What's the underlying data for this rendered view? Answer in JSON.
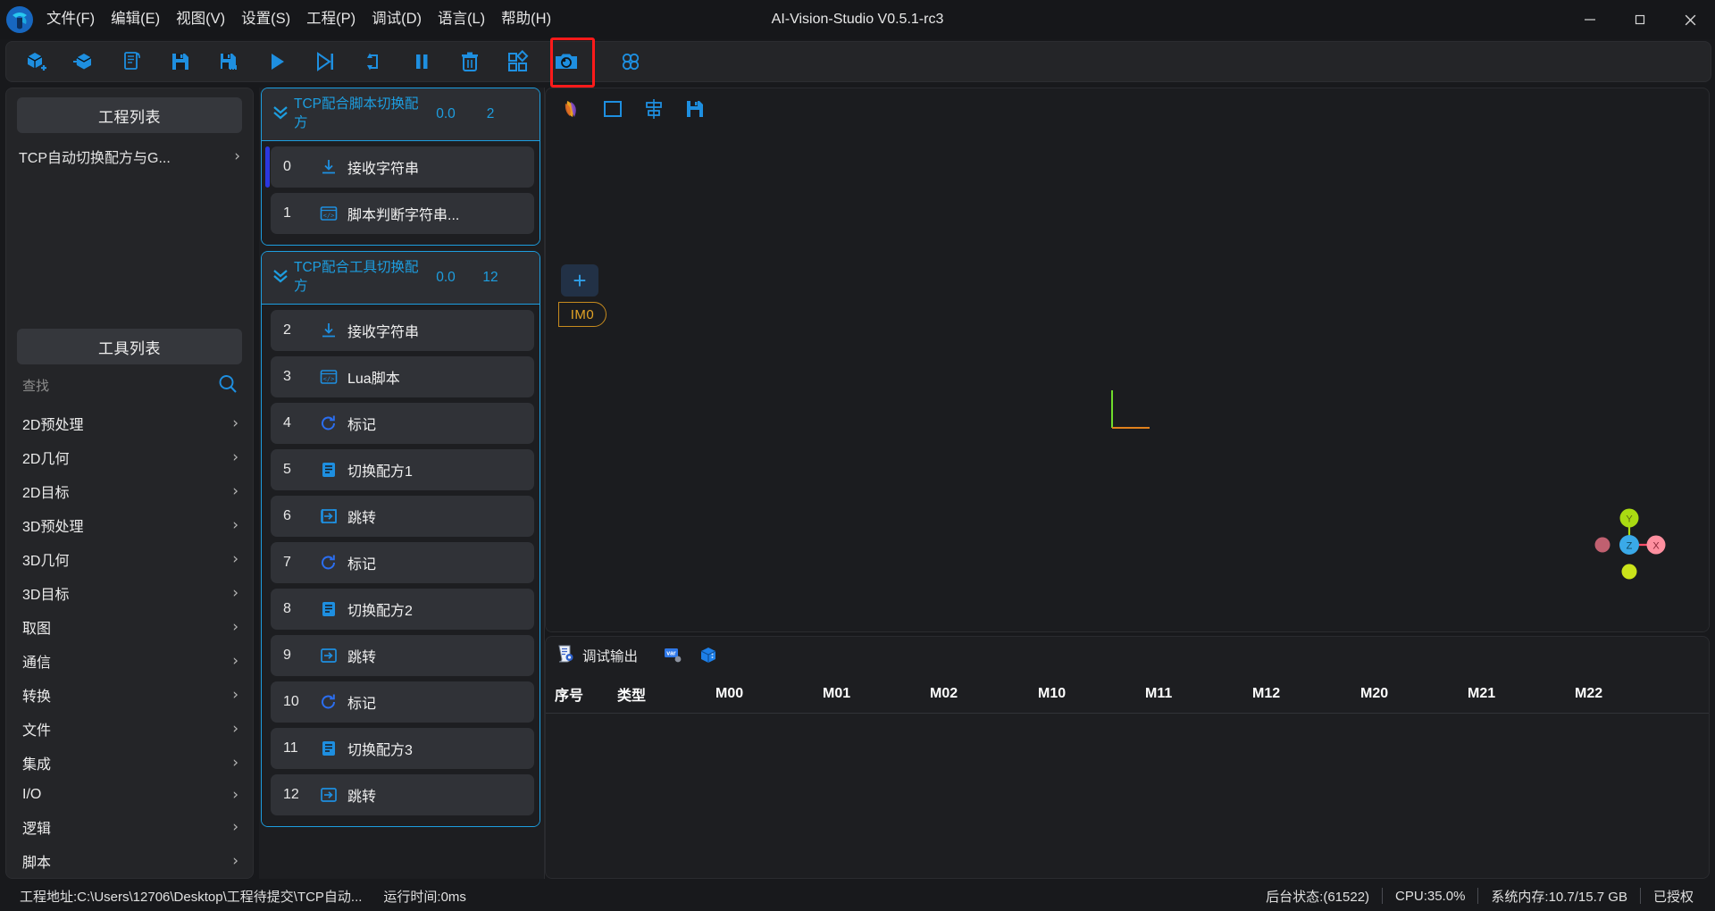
{
  "window": {
    "title": "AI-Vision-Studio V0.5.1-rc3",
    "logo_icon": "app-logo-icon",
    "minimize_label": "—",
    "maximize_label": "❐",
    "close_label": "✕"
  },
  "menubar": {
    "items": [
      {
        "label": "文件(F)",
        "name": "menu-file"
      },
      {
        "label": "编辑(E)",
        "name": "menu-edit"
      },
      {
        "label": "视图(V)",
        "name": "menu-view"
      },
      {
        "label": "设置(S)",
        "name": "menu-settings"
      },
      {
        "label": "工程(P)",
        "name": "menu-project"
      },
      {
        "label": "调试(D)",
        "name": "menu-debug"
      },
      {
        "label": "语言(L)",
        "name": "menu-language"
      },
      {
        "label": "帮助(H)",
        "name": "menu-help"
      }
    ]
  },
  "toolbar": {
    "highlight_color": "#ff1a1a",
    "buttons": [
      {
        "icon": "add-project-icon",
        "name": "toolbar-new-project"
      },
      {
        "icon": "open-project-icon",
        "name": "toolbar-open-project"
      },
      {
        "icon": "copy-project-icon",
        "name": "toolbar-copy-project"
      },
      {
        "icon": "save-icon",
        "name": "toolbar-save"
      },
      {
        "icon": "save-as-icon",
        "name": "toolbar-save-as"
      },
      {
        "icon": "run-icon",
        "name": "toolbar-run"
      },
      {
        "icon": "step-icon",
        "name": "toolbar-step"
      },
      {
        "icon": "loop-icon",
        "name": "toolbar-loop-run"
      },
      {
        "icon": "pause-icon",
        "name": "toolbar-pause"
      },
      {
        "icon": "delete-icon",
        "name": "toolbar-delete"
      },
      {
        "icon": "modules-icon",
        "name": "toolbar-modules"
      },
      {
        "icon": "camera-icon",
        "name": "toolbar-camera"
      },
      {
        "icon": "grid-icon",
        "name": "toolbar-grid"
      }
    ]
  },
  "left_panel": {
    "project_list_title": "工程列表",
    "projects": [
      {
        "label": "TCP自动切换配方与G...",
        "name": "project-item-tcp"
      }
    ],
    "tool_list_title": "工具列表",
    "search": {
      "placeholder": "查找",
      "value": "",
      "icon": "search-icon"
    },
    "tool_categories": [
      {
        "label": "2D预处理",
        "name": "tool-cat-2d-preprocess"
      },
      {
        "label": "2D几何",
        "name": "tool-cat-2d-geometry"
      },
      {
        "label": "2D目标",
        "name": "tool-cat-2d-target"
      },
      {
        "label": "3D预处理",
        "name": "tool-cat-3d-preprocess"
      },
      {
        "label": "3D几何",
        "name": "tool-cat-3d-geometry"
      },
      {
        "label": "3D目标",
        "name": "tool-cat-3d-target"
      },
      {
        "label": "取图",
        "name": "tool-cat-acquire"
      },
      {
        "label": "通信",
        "name": "tool-cat-communication"
      },
      {
        "label": "转换",
        "name": "tool-cat-convert"
      },
      {
        "label": "文件",
        "name": "tool-cat-file"
      },
      {
        "label": "集成",
        "name": "tool-cat-integration"
      },
      {
        "label": "I/O",
        "name": "tool-cat-io"
      },
      {
        "label": "逻辑",
        "name": "tool-cat-logic"
      },
      {
        "label": "脚本",
        "name": "tool-cat-script"
      }
    ]
  },
  "flow_panel": {
    "groups": [
      {
        "name": "flow-group-script-switch",
        "title": "TCP配合脚本切换配方",
        "time": "0.0",
        "count": "2",
        "chevron_icon": "chevron-double-down-icon",
        "steps": [
          {
            "index": "0",
            "label": "接收字符串",
            "icon": "receive-string-icon",
            "selected": true
          },
          {
            "index": "1",
            "label": "脚本判断字符串...",
            "icon": "script-icon",
            "selected": false
          }
        ]
      },
      {
        "name": "flow-group-tool-switch",
        "title": "TCP配合工具切换配方",
        "time": "0.0",
        "count": "12",
        "chevron_icon": "chevron-double-down-icon",
        "steps": [
          {
            "index": "2",
            "label": "接收字符串",
            "icon": "receive-string-icon",
            "selected": false
          },
          {
            "index": "3",
            "label": "Lua脚本",
            "icon": "script-icon",
            "selected": false
          },
          {
            "index": "4",
            "label": "标记",
            "icon": "mark-icon",
            "selected": false
          },
          {
            "index": "5",
            "label": "切换配方1",
            "icon": "recipe-icon",
            "selected": false
          },
          {
            "index": "6",
            "label": "跳转",
            "icon": "jump-icon",
            "selected": false
          },
          {
            "index": "7",
            "label": "标记",
            "icon": "mark-icon",
            "selected": false
          },
          {
            "index": "8",
            "label": "切换配方2",
            "icon": "recipe-icon",
            "selected": false
          },
          {
            "index": "9",
            "label": "跳转",
            "icon": "jump-icon",
            "selected": false
          },
          {
            "index": "10",
            "label": "标记",
            "icon": "mark-icon",
            "selected": false
          },
          {
            "index": "11",
            "label": "切换配方3",
            "icon": "recipe-icon",
            "selected": false
          },
          {
            "index": "12",
            "label": "跳转",
            "icon": "jump-icon",
            "selected": false
          }
        ]
      }
    ]
  },
  "viewer": {
    "toolbar_buttons": [
      {
        "icon": "color-ribbon-icon",
        "name": "viewer-render-mode"
      },
      {
        "icon": "rectangle-icon",
        "name": "viewer-rectangle-tool"
      },
      {
        "icon": "align-icon",
        "name": "viewer-align-tool"
      },
      {
        "icon": "save-icon",
        "name": "viewer-save-image"
      }
    ],
    "add_button_label": "+",
    "image_tag": "IM0",
    "gizmo": {
      "axis_x": "X",
      "axis_y": "Y",
      "axis_z": "Z",
      "color_x": "#ff4d6a",
      "color_y": "#aada12",
      "color_z": "#3aa9e8"
    }
  },
  "debug": {
    "title": "调试输出",
    "title_icon": "debug-output-icon",
    "buttons": [
      {
        "icon": "variable-icon",
        "name": "debug-variables-button"
      },
      {
        "icon": "cube-icon",
        "name": "debug-3d-button"
      }
    ],
    "columns": [
      "序号",
      "类型",
      "M00",
      "M01",
      "M02",
      "M10",
      "M11",
      "M12",
      "M20",
      "M21",
      "M22"
    ],
    "rows": []
  },
  "statusbar": {
    "project_path": "工程地址:C:\\Users\\12706\\Desktop\\工程待提交\\TCP自动...",
    "run_time": "运行时间:0ms",
    "backend_status": "后台状态:(61522)",
    "cpu": "CPU:35.0%",
    "memory": "系统内存:10.7/15.7 GB",
    "license": "已授权"
  }
}
